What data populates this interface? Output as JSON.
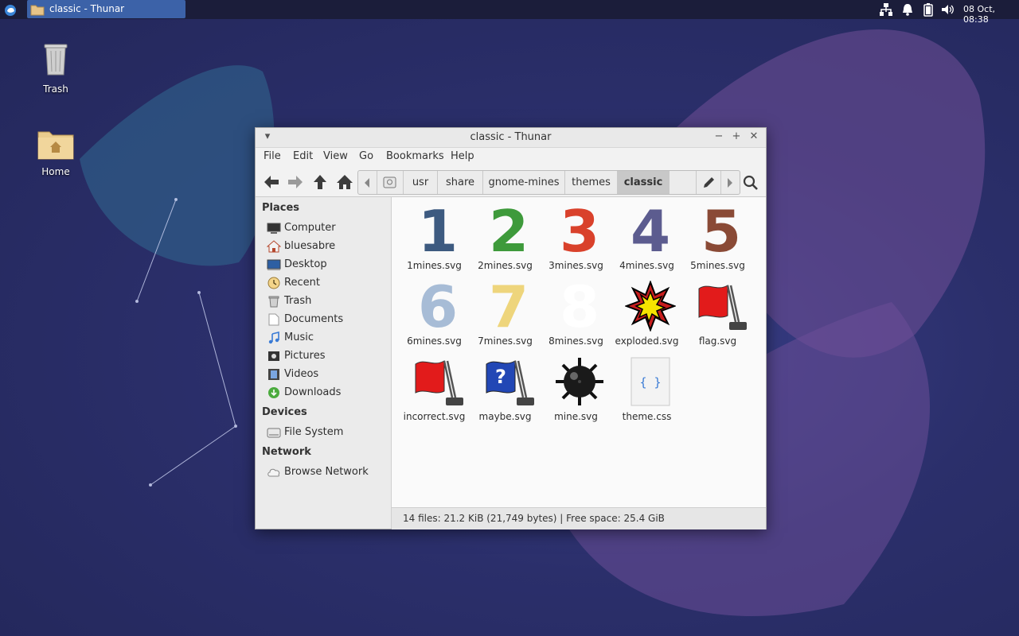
{
  "panel": {
    "task_title": "classic - Thunar",
    "clock": "08 Oct, 08:38"
  },
  "desktop": {
    "icons": [
      {
        "label": "Trash"
      },
      {
        "label": "Home"
      }
    ]
  },
  "window": {
    "title": "classic - Thunar",
    "menu": [
      "File",
      "Edit",
      "Go",
      "Bookmarks",
      "Help"
    ],
    "view_menu": "View",
    "path": [
      "usr",
      "share",
      "gnome-mines",
      "themes",
      "classic"
    ],
    "sidebar": {
      "places_heading": "Places",
      "places": [
        "Computer",
        "bluesabre",
        "Desktop",
        "Recent",
        "Trash",
        "Documents",
        "Music",
        "Pictures",
        "Videos",
        "Downloads"
      ],
      "devices_heading": "Devices",
      "devices": [
        "File System"
      ],
      "network_heading": "Network",
      "network": [
        "Browse Network"
      ]
    },
    "files": [
      {
        "name": "1mines.svg",
        "glyph": "1",
        "color": "#3d5a80"
      },
      {
        "name": "2mines.svg",
        "glyph": "2",
        "color": "#3e9a3b"
      },
      {
        "name": "3mines.svg",
        "glyph": "3",
        "color": "#d9412b"
      },
      {
        "name": "4mines.svg",
        "glyph": "4",
        "color": "#5c5c8f"
      },
      {
        "name": "5mines.svg",
        "glyph": "5",
        "color": "#8a4a36"
      },
      {
        "name": "6mines.svg",
        "glyph": "6",
        "color": "#a7bcd6"
      },
      {
        "name": "7mines.svg",
        "glyph": "7",
        "color": "#eed57c"
      },
      {
        "name": "8mines.svg",
        "glyph": "8",
        "color": "#ffffff"
      },
      {
        "name": "exploded.svg",
        "icon": "explosion-icon"
      },
      {
        "name": "flag.svg",
        "icon": "flag-icon"
      },
      {
        "name": "incorrect.svg",
        "icon": "incorrect-flag-icon"
      },
      {
        "name": "maybe.svg",
        "icon": "maybe-flag-icon"
      },
      {
        "name": "mine.svg",
        "icon": "mine-icon"
      },
      {
        "name": "theme.css",
        "icon": "css-file-icon"
      }
    ],
    "status": "14 files: 21.2 KiB (21,749 bytes)  |  Free space: 25.4 GiB"
  }
}
